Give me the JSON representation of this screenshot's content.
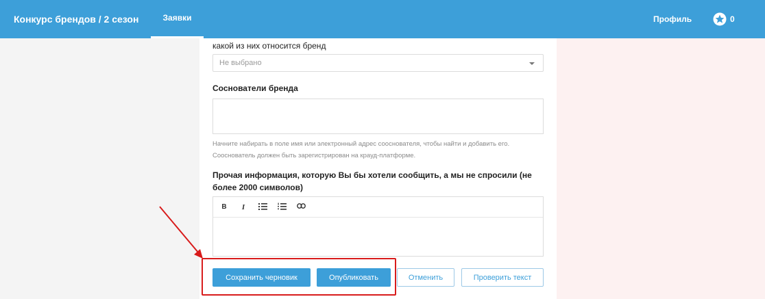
{
  "navbar": {
    "brand": "Конкурс брендов / 2 сезон",
    "active_tab": "Заявки",
    "profile": "Профиль",
    "stars_count": "0"
  },
  "form": {
    "industry_label_tail": "какой из них относится бренд",
    "industry_select_value": "Не выбрано",
    "cofounders_label": "Соснователи бренда",
    "cofounders_help": "Начните набирать в поле имя или электронный адрес сооснователя, чтобы найти и добавить его. Сооснователь должен быть зарегистрирован на крауд-платформе.",
    "other_info_label": "Прочая информация, которую Вы бы хотели сообщить, а мы не спросили (не более 2000 символов)",
    "toolbar": {
      "bold": "B",
      "italic": "I"
    }
  },
  "actions": {
    "save_draft": "Сохранить черновик",
    "publish": "Опубликовать",
    "cancel": "Отменить",
    "check_text": "Проверить текст"
  },
  "colors": {
    "accent": "#3d9fd9",
    "annotation": "#d81b1b"
  }
}
